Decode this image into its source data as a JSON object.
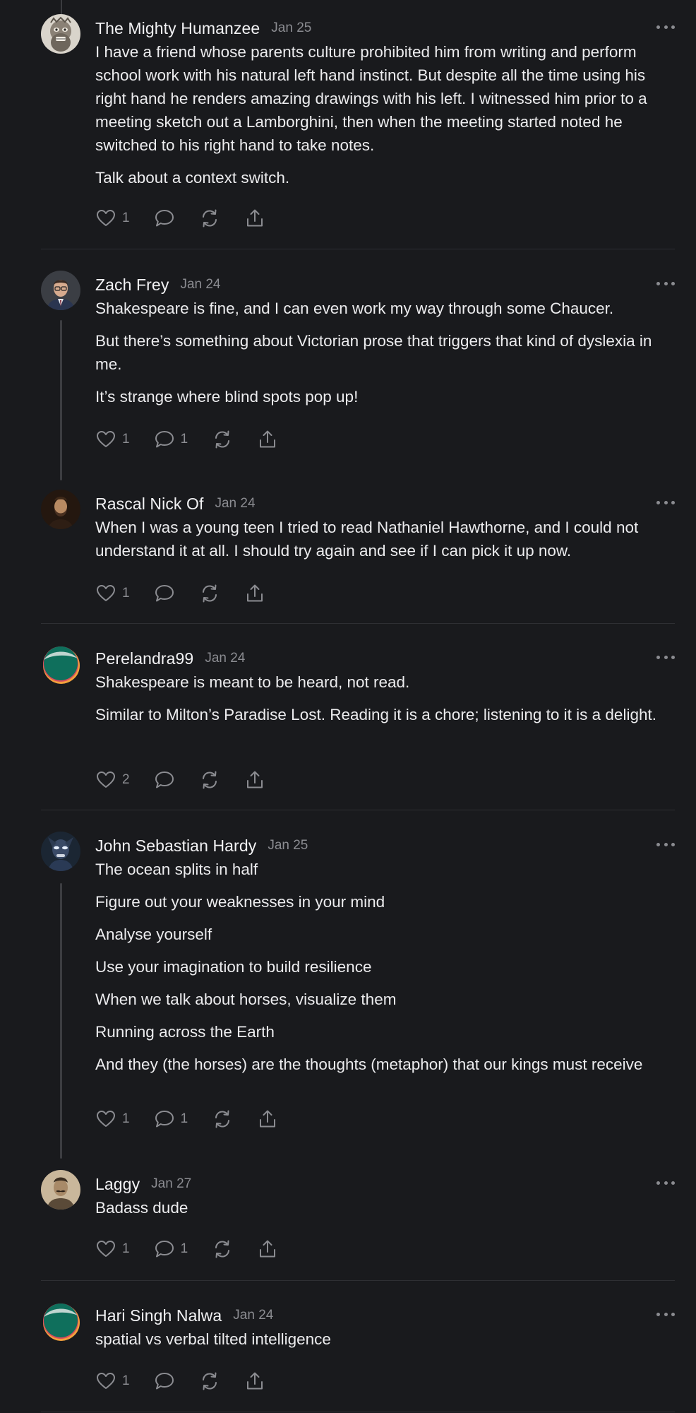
{
  "comments": [
    {
      "author": "The Mighty Humanzee",
      "date": "Jan 25",
      "avatar_icon": "mask-face-avatar",
      "paragraphs": [
        "I have a friend whose parents culture prohibited him from writing and perform school work with his natural left hand instinct. But despite all the time using his right hand he renders amazing drawings with his left. I witnessed him prior to a meeting sketch out a Lamborghini, then when the meeting started noted he switched to his right hand to take notes.",
        "Talk about a context switch."
      ],
      "likes": "1",
      "replies": ""
    },
    {
      "author": "Zach Frey",
      "date": "Jan 24",
      "avatar_icon": "man-glasses-avatar",
      "paragraphs": [
        "Shakespeare is fine, and I can even work my way through some Chaucer.",
        "But there’s something about Victorian prose that triggers that kind of dyslexia in me.",
        "It’s strange where blind spots pop up!"
      ],
      "likes": "1",
      "replies": "1"
    },
    {
      "author": "Rascal Nick Of",
      "date": "Jan 24",
      "avatar_icon": "bearded-man-portrait-avatar",
      "paragraphs": [
        "When I was a young teen I tried to read Nathaniel Hawthorne, and I could not understand it at all. I should try again and see if I can pick it up now."
      ],
      "likes": "1",
      "replies": ""
    },
    {
      "author": "Perelandra99",
      "date": "Jan 24",
      "avatar_icon": "green-orange-circle-avatar",
      "paragraphs": [
        "Shakespeare is meant to be heard, not read.",
        "Similar to Milton’s Paradise Lost. Reading it is a chore; listening to it is a delight."
      ],
      "likes": "2",
      "replies": ""
    },
    {
      "author": "John Sebastian Hardy",
      "date": "Jan 25",
      "avatar_icon": "masked-hero-avatar",
      "paragraphs": [
        "The ocean splits in half",
        "Figure out your weaknesses in your mind",
        "Analyse yourself",
        "Use your imagination to build resilience",
        "When we talk about horses, visualize them",
        "Running across the Earth",
        "And they (the horses) are the thoughts (metaphor) that our kings must receive"
      ],
      "likes": "1",
      "replies": "1"
    },
    {
      "author": "Laggy",
      "date": "Jan 27",
      "avatar_icon": "mustache-man-avatar",
      "paragraphs": [
        "Badass dude"
      ],
      "likes": "1",
      "replies": "1"
    },
    {
      "author": "Hari Singh Nalwa",
      "date": "Jan 24",
      "avatar_icon": "green-orange-circle-avatar",
      "paragraphs": [
        "spatial vs verbal tilted intelligence"
      ],
      "likes": "1",
      "replies": ""
    }
  ],
  "icons": {
    "like": "heart-icon",
    "reply": "speech-bubble-icon",
    "restack": "restack-icon",
    "share": "share-icon",
    "more": "more-dots-icon"
  },
  "colors": {
    "background": "#191a1d",
    "text": "#ececee",
    "muted": "#8b8c91"
  }
}
